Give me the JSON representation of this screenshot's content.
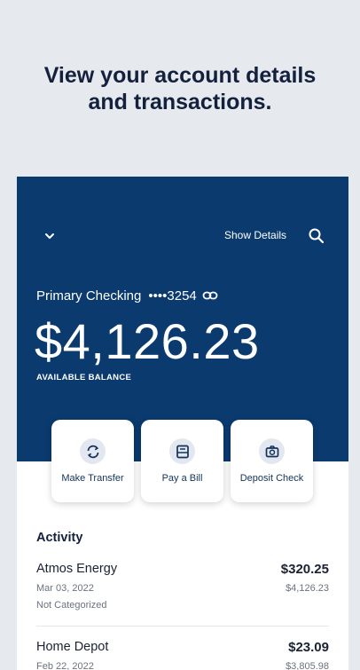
{
  "headline": {
    "line1": "View your account details",
    "line2": "and transactions."
  },
  "header": {
    "show_details": "Show Details",
    "chevron_icon": "chevron-down-icon",
    "search_icon": "search-icon"
  },
  "account": {
    "name": "Primary Checking",
    "masked_number": "••••3254",
    "balance": "$4,126.23",
    "balance_label": "AVAILABLE BALANCE"
  },
  "actions": [
    {
      "label": "Make Transfer",
      "icon": "transfer-icon"
    },
    {
      "label": "Pay a Bill",
      "icon": "bill-icon"
    },
    {
      "label": "Deposit Check",
      "icon": "camera-icon"
    }
  ],
  "activity": {
    "title": "Activity",
    "transactions": [
      {
        "name": "Atmos Energy",
        "amount": "$320.25",
        "date": "Mar 03, 2022",
        "balance": "$4,126.23",
        "category": "Not Categorized"
      },
      {
        "name": "Home Depot",
        "amount": "$23.09",
        "date": "Feb 22, 2022",
        "balance": "$3,805.98"
      }
    ]
  },
  "colors": {
    "hero": "#0a3a6e",
    "background": "#e6e9ee",
    "headline": "#14213d"
  }
}
